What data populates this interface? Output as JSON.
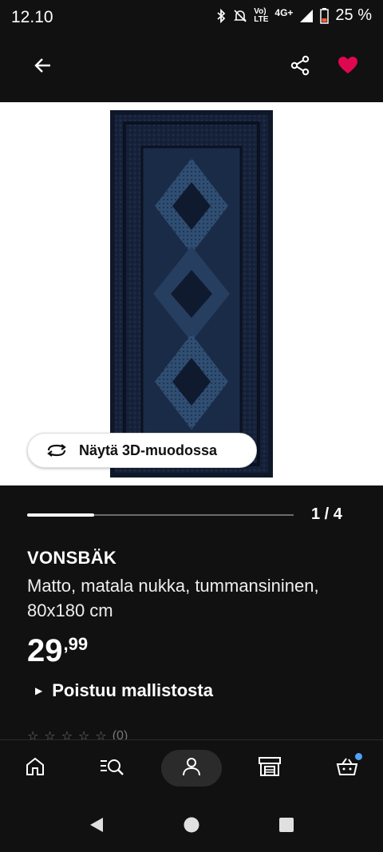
{
  "status_bar": {
    "time": "12.10",
    "network_label_top": "Vo)",
    "network_label_bottom": "LTE",
    "network_type": "4G+",
    "battery": "25 %"
  },
  "app_bar": {
    "back_icon": "arrow-left-icon",
    "share_icon": "share-icon",
    "favorite_icon": "heart-icon",
    "favorite_color": "#e00751"
  },
  "gallery": {
    "view_3d_label": "Näytä 3D-muodossa",
    "page_indicator": "1 / 4",
    "progress_fraction": 0.25
  },
  "product": {
    "name": "VONSBÄK",
    "description": "Matto, matala nukka, tummansininen, 80x180 cm",
    "price_integer": "29",
    "price_decimal": ",99",
    "availability": "Poistuu mallistosta",
    "rating_count": "(0)"
  },
  "bottom_nav": {
    "items": [
      "home-icon",
      "search-list-icon",
      "profile-icon",
      "store-icon",
      "cart-icon"
    ],
    "active": "profile-icon",
    "cart_badge_color": "#4da3ff"
  },
  "system_nav": {
    "items": [
      "back-triangle-icon",
      "home-circle-icon",
      "recents-square-icon"
    ]
  }
}
